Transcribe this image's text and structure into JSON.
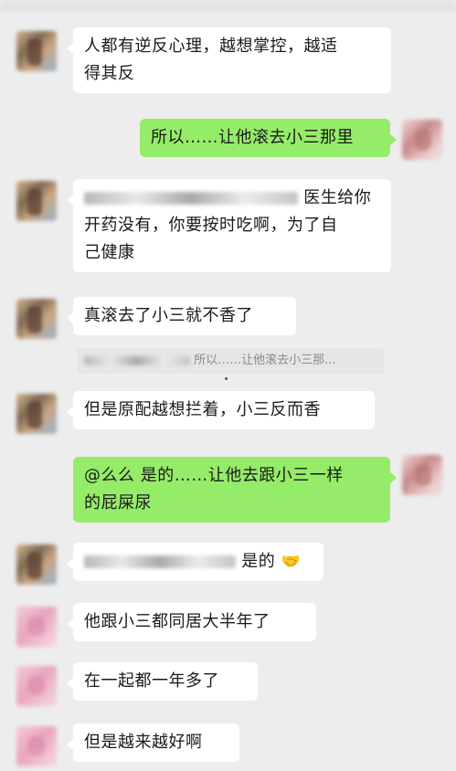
{
  "messages": [
    {
      "text_1": "人都有逆反心理，越想掌控，越适",
      "text_2": "得其反"
    },
    {
      "text": "所以……让他滚去小三那里"
    },
    {
      "text_1": "医生给你",
      "text_2": "开药没有，你要按时吃啊，为了自",
      "text_3": "己健康"
    },
    {
      "text": "真滚去了小三就不香了"
    },
    {
      "quote": "所以……让他滚去小三那..."
    },
    {
      "text": "但是原配越想拦着，小三反而香"
    },
    {
      "text_1": "@么么  是的……让他去跟小三一样",
      "text_2": "的屁屎尿"
    },
    {
      "text": "是的",
      "emoji": "🤝"
    },
    {
      "text": "他跟小三都同居大半年了"
    },
    {
      "text": "在一起都一年多了"
    },
    {
      "text": "但是越来越好啊"
    }
  ],
  "colors": {
    "background": "#ededed",
    "incoming": "#ffffff",
    "outgoing": "#95ec69"
  }
}
